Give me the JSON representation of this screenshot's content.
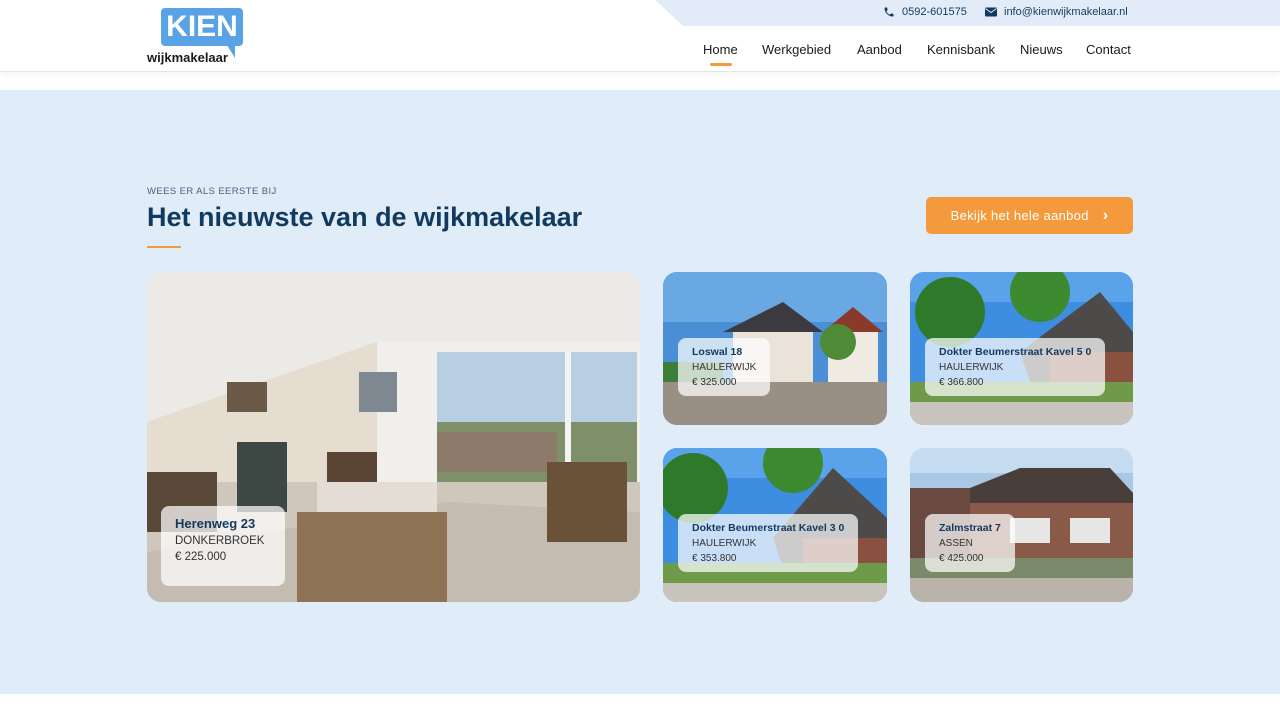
{
  "header": {
    "logo_word": "KIEN",
    "logo_sub": "wijkmakelaar",
    "phone": "0592-601575",
    "email": "info@kienwijkmakelaar.nl",
    "nav": [
      {
        "label": "Home",
        "active": true
      },
      {
        "label": "Werkgebied"
      },
      {
        "label": "Aanbod"
      },
      {
        "label": "Kennisbank"
      },
      {
        "label": "Nieuws"
      },
      {
        "label": "Contact"
      }
    ]
  },
  "section": {
    "eyebrow": "WEES ER ALS EERSTE BIJ",
    "title": "Het nieuwste van de wijkmakelaar",
    "cta_label": "Bekijk het hele aanbod"
  },
  "listings": [
    {
      "street": "Herenweg 23",
      "city": "DONKERBROEK",
      "price": "€ 225.000"
    },
    {
      "street": "Loswal 18",
      "city": "HAULERWIJK",
      "price": "€ 325.000"
    },
    {
      "street": "Dokter Beumerstraat Kavel 5 0",
      "city": "HAULERWIJK",
      "price": "€ 366.800"
    },
    {
      "street": "Dokter Beumerstraat Kavel 3 0",
      "city": "HAULERWIJK",
      "price": "€ 353.800"
    },
    {
      "street": "Zalmstraat 7",
      "city": "ASSEN",
      "price": "€ 425.000"
    }
  ],
  "colors": {
    "accent": "#f59a3c",
    "navy": "#123a5e",
    "section_bg": "#e0ecf8",
    "logo_blue": "#5aa2e6"
  }
}
